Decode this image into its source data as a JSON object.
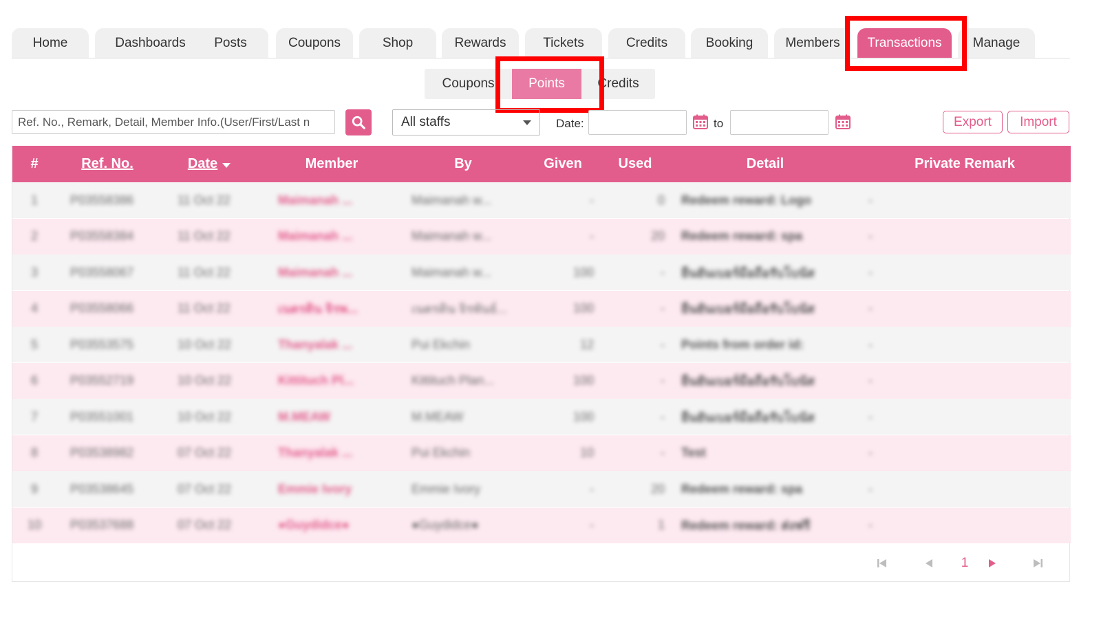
{
  "nav": {
    "tabs": [
      {
        "label": "Home"
      },
      {
        "label": "Dashboards"
      },
      {
        "label": "Posts"
      },
      {
        "label": "Coupons"
      },
      {
        "label": "Shop"
      },
      {
        "label": "Rewards"
      },
      {
        "label": "Tickets"
      },
      {
        "label": "Credits"
      },
      {
        "label": "Booking"
      },
      {
        "label": "Members"
      },
      {
        "label": "Transactions"
      },
      {
        "label": "Manage"
      }
    ],
    "active": "Transactions"
  },
  "subtabs": {
    "items": [
      {
        "label": "Coupons"
      },
      {
        "label": "Points"
      },
      {
        "label": "Credits"
      }
    ],
    "active": "Points"
  },
  "filters": {
    "search_placeholder": "Ref. No., Remark, Detail, Member Info.(User/First/Last n",
    "staff_selected": "All staffs",
    "date_label": "Date:",
    "to_label": "to",
    "export_label": "Export",
    "import_label": "Import"
  },
  "table": {
    "headers": {
      "num": "#",
      "ref": "Ref. No.",
      "date": "Date",
      "member": "Member",
      "by": "By",
      "given": "Given",
      "used": "Used",
      "detail": "Detail",
      "remark": "Private Remark"
    },
    "rows": [
      {
        "num": "1",
        "ref": "P03558386",
        "date": "11 Oct 22",
        "member": "Maimanah ...",
        "by": "Maimanah w...",
        "given": "-",
        "used": "0",
        "detail": "Redeem reward: Logo",
        "remark": "-"
      },
      {
        "num": "2",
        "ref": "P03558384",
        "date": "11 Oct 22",
        "member": "Maimanah ...",
        "by": "Maimanah w...",
        "given": "-",
        "used": "20",
        "detail": "Redeem reward: spa",
        "remark": "-"
      },
      {
        "num": "3",
        "ref": "P03558067",
        "date": "11 Oct 22",
        "member": "Maimanah ...",
        "by": "Maimanah w...",
        "given": "100",
        "used": "-",
        "detail": "ยืนยันเบอร์มือถือรับโบนัส",
        "remark": "-"
      },
      {
        "num": "4",
        "ref": "P03558066",
        "date": "11 Oct 22",
        "member": "เนตรดิน จิรพ...",
        "by": "เนตรดิน จิรพันธ์...",
        "given": "100",
        "used": "-",
        "detail": "ยืนยันเบอร์มือถือรับโบนัส",
        "remark": "-"
      },
      {
        "num": "5",
        "ref": "P03553575",
        "date": "10 Oct 22",
        "member": "Thanyalak ...",
        "by": "Pui Ekchin",
        "given": "12",
        "used": "-",
        "detail": "Points from order id:",
        "remark": "-"
      },
      {
        "num": "6",
        "ref": "P03552719",
        "date": "10 Oct 22",
        "member": "Kittituch Pl...",
        "by": "Kittituch Plan...",
        "given": "100",
        "used": "-",
        "detail": "ยืนยันเบอร์มือถือรับโบนัส",
        "remark": "-"
      },
      {
        "num": "7",
        "ref": "P03551001",
        "date": "10 Oct 22",
        "member": "M.MEAW",
        "by": "M.MEAW",
        "given": "100",
        "used": "-",
        "detail": "ยืนยันเบอร์มือถือรับโบนัส",
        "remark": "-"
      },
      {
        "num": "8",
        "ref": "P03538982",
        "date": "07 Oct 22",
        "member": "Thanyalak ...",
        "by": "Pui Ekchin",
        "given": "10",
        "used": "-",
        "detail": "Test",
        "remark": "-"
      },
      {
        "num": "9",
        "ref": "P03538645",
        "date": "07 Oct 22",
        "member": "Emmie Ivory",
        "by": "Emmie Ivory",
        "given": "-",
        "used": "20",
        "detail": "Redeem reward: spa",
        "remark": "-"
      },
      {
        "num": "10",
        "ref": "P03537688",
        "date": "07 Oct 22",
        "member": "●Guydidce●",
        "by": "●Guydidce●",
        "given": "-",
        "used": "1",
        "detail": "Redeem reward: ส่งฟรี",
        "remark": "-"
      }
    ]
  },
  "pagination": {
    "current_page": "1"
  },
  "colors": {
    "accent": "#e35d8c",
    "highlight": "#ff0000"
  }
}
